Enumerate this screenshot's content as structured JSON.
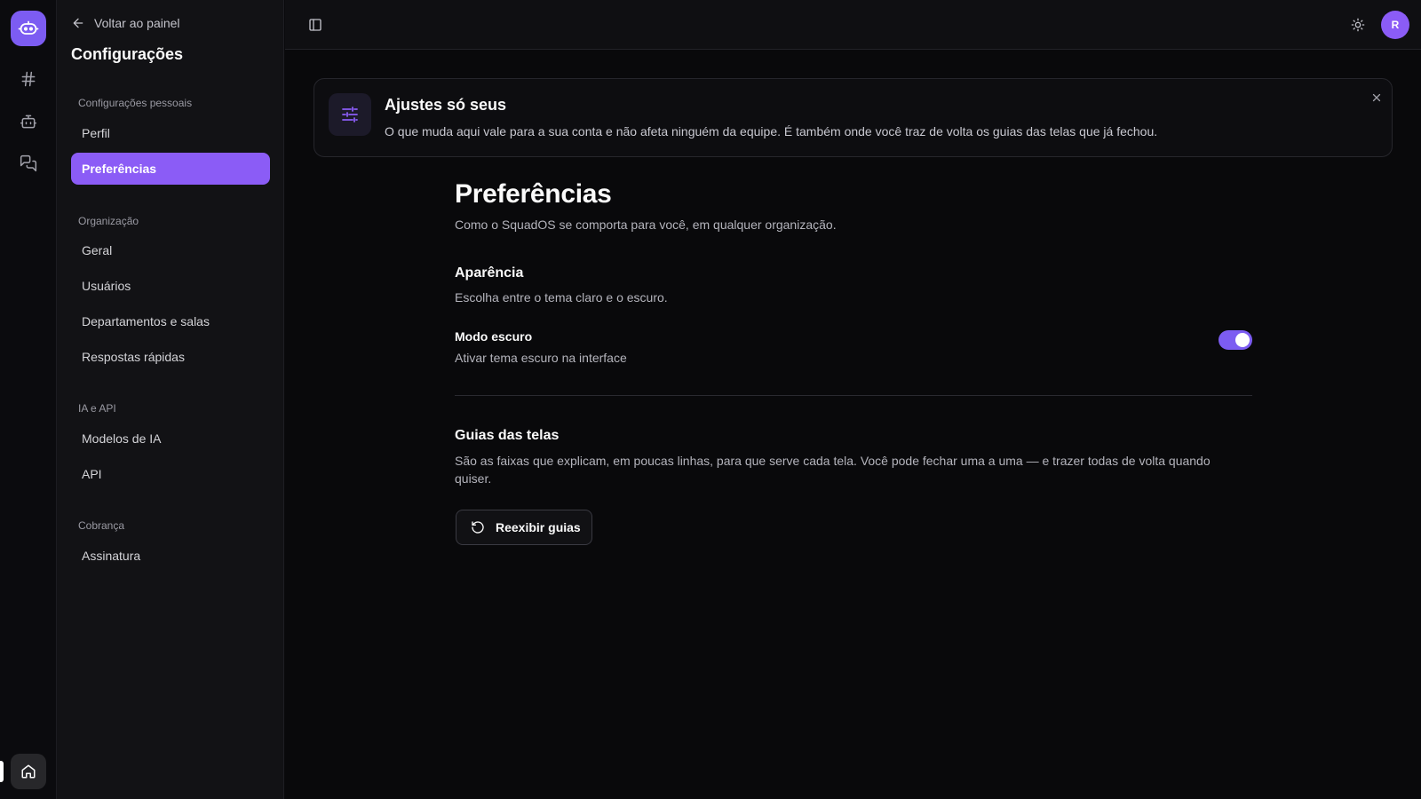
{
  "rail": {
    "logo_icon": "bot-face-icon",
    "items": [
      {
        "icon": "hash-icon"
      },
      {
        "icon": "robot-icon"
      },
      {
        "icon": "chat-bubbles-icon"
      }
    ],
    "home_icon": "home-icon"
  },
  "sidebar": {
    "back_label": "Voltar ao painel",
    "title": "Configurações",
    "sections": [
      {
        "label": "Configurações pessoais",
        "items": [
          "Perfil",
          "Preferências"
        ]
      },
      {
        "label": "Organização",
        "items": [
          "Geral",
          "Usuários",
          "Departamentos e salas",
          "Respostas rápidas"
        ]
      },
      {
        "label": "IA e API",
        "items": [
          "Modelos de IA",
          "API"
        ]
      },
      {
        "label": "Cobrança",
        "items": [
          "Assinatura"
        ]
      }
    ],
    "active_item": "Preferências"
  },
  "topbar": {
    "avatar_initial": "R"
  },
  "banner": {
    "title": "Ajustes só seus",
    "text": "O que muda aqui vale para a sua conta e não afeta ninguém da equipe. É também onde você traz de volta os guias das telas que já fechou."
  },
  "main": {
    "title": "Preferências",
    "subtitle": "Como o SquadOS se comporta para você, em qualquer organização.",
    "appearance": {
      "title": "Aparência",
      "desc": "Escolha entre o tema claro e o escuro.",
      "dark_mode_label": "Modo escuro",
      "dark_mode_desc": "Ativar tema escuro na interface",
      "dark_mode_on": true
    },
    "guides": {
      "title": "Guias das telas",
      "desc": "São as faixas que explicam, em poucas linhas, para que serve cada tela. Você pode fechar uma a uma — e trazer todas de volta quando quiser.",
      "button_label": "Reexibir guias"
    }
  },
  "colors": {
    "accent": "#8b5cf6",
    "background": "#09090b",
    "sidebar": "#121215"
  }
}
